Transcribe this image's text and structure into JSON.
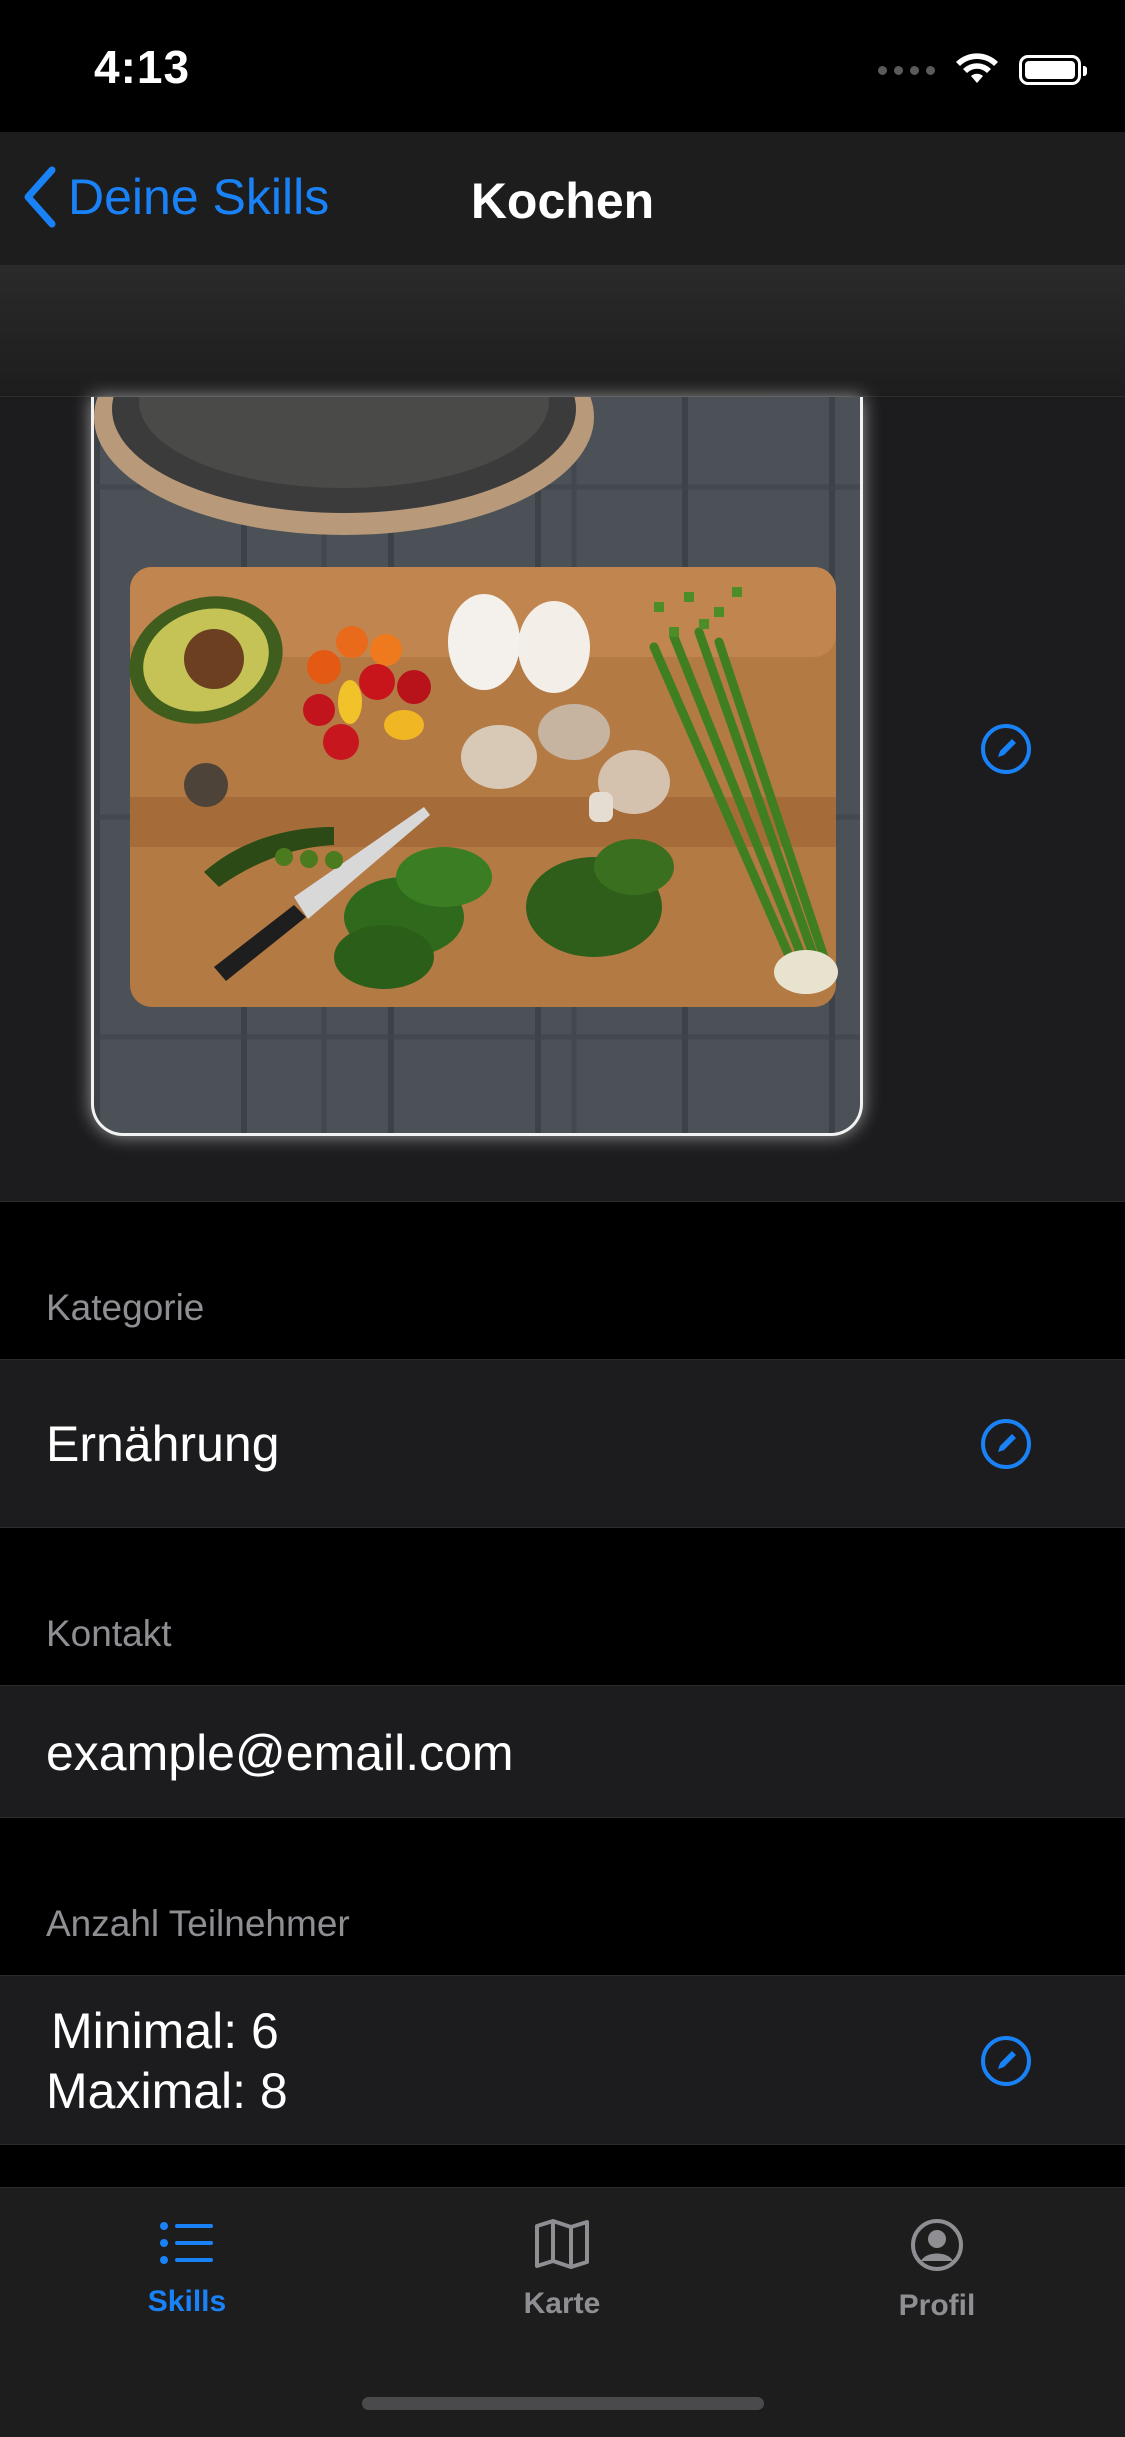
{
  "status_bar": {
    "time": "4:13"
  },
  "nav": {
    "back_label": "Deine Skills",
    "title": "Kochen"
  },
  "sections": {
    "kategorie": {
      "header": "Kategorie",
      "value": "Ernährung"
    },
    "kontakt": {
      "header": "Kontakt",
      "value": "example@email.com"
    },
    "teilnehmer": {
      "header": "Anzahl Teilnehmer",
      "min": "Minimal: 6",
      "max": "Maximal: 8"
    }
  },
  "tabs": [
    {
      "label": "Skills",
      "icon": "list-icon",
      "active": true
    },
    {
      "label": "Karte",
      "icon": "map-icon",
      "active": false
    },
    {
      "label": "Profil",
      "icon": "profile-icon",
      "active": false
    }
  ],
  "colors": {
    "accent": "#1a82f7",
    "background": "#000000",
    "cell": "#1c1c1e",
    "secondary_text": "#8e8e93"
  }
}
